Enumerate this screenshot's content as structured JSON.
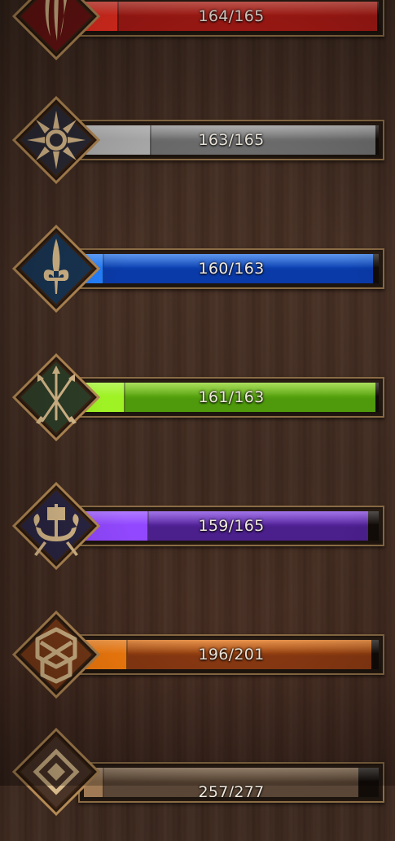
{
  "skill_lines": [
    {
      "id": "red",
      "icon": "three-claws-icon",
      "value_text": "164/165",
      "progress": 0.994,
      "color": "#b01b16",
      "xp_color": "#d62a1d",
      "xp": 0.12,
      "emblem_bg": "#6a1412"
    },
    {
      "id": "grey",
      "icon": "sun-icon",
      "value_text": "163/165",
      "progress": 0.988,
      "color": "#6e6e6e",
      "xp_color": "#9b9b9b",
      "xp": 0.23,
      "emblem_bg": "#2b2a35"
    },
    {
      "id": "blue",
      "icon": "fleur-de-lis-icon",
      "value_text": "160/163",
      "progress": 0.982,
      "color": "#0a3aa8",
      "xp_color": "#1f6ee6",
      "xp": 0.07,
      "emblem_bg": "#193553"
    },
    {
      "id": "green",
      "icon": "crossed-arrows-icon",
      "value_text": "161/163",
      "progress": 0.988,
      "color": "#4e9a0c",
      "xp_color": "#8ad21f",
      "xp": 0.14,
      "emblem_bg": "#2d3d27"
    },
    {
      "id": "purple",
      "icon": "longship-icon",
      "value_text": "159/165",
      "progress": 0.964,
      "color": "#4b1f8c",
      "xp_color": "#7f3fe0",
      "xp": 0.22,
      "emblem_bg": "#2a2542"
    },
    {
      "id": "orange",
      "icon": "knot-shield-icon",
      "value_text": "196/201",
      "progress": 0.975,
      "color": "#8c3a12",
      "xp_color": "#e8700c",
      "xp": 0.15,
      "emblem_bg": "#7a3a17"
    },
    {
      "id": "tan",
      "icon": "diamond-rune-icon",
      "value_text": "257/277",
      "progress": 0.93,
      "color": "#5a4636",
      "xp_color": "#8a6a4a",
      "xp": 0.07,
      "emblem_bg": "#4a3428"
    }
  ]
}
